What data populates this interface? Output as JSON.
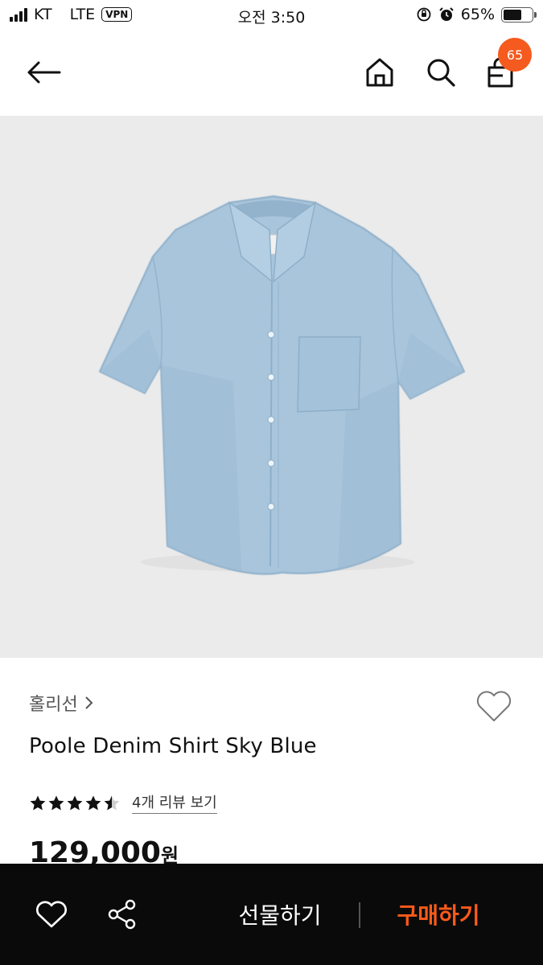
{
  "status_bar": {
    "carrier": "KT",
    "network": "LTE",
    "vpn": "VPN",
    "time": "오전 3:50",
    "battery": "65%",
    "battery_level": 0.65
  },
  "header": {
    "icons": [
      "back-arrow-icon",
      "home-icon",
      "search-icon",
      "shopping-bag-icon"
    ],
    "cart_count": "65"
  },
  "product": {
    "brand": "홀리선",
    "name": "Poole Denim Shirt Sky Blue",
    "rating": 4.5,
    "rating_max": 5,
    "review_link": "4개 리뷰 보기",
    "price": "129,000",
    "price_unit": "원"
  },
  "bottom_bar": {
    "gift_label": "선물하기",
    "buy_label": "구매하기",
    "accent_color": "#ff5a1a"
  },
  "colors": {
    "badge": "#f55a1f",
    "image_bg": "#ebebeb",
    "shirt": "#a8c5dc"
  }
}
